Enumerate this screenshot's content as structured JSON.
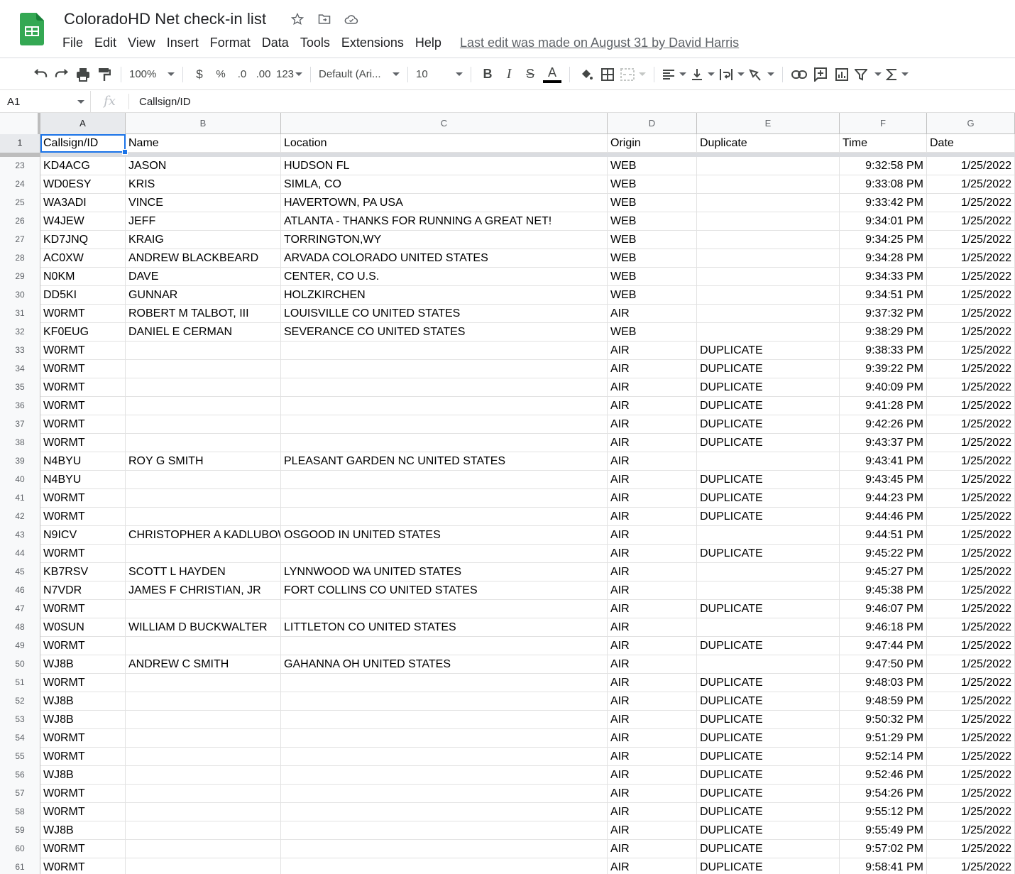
{
  "app": {
    "doc_title": "ColoradoHD Net check-in list",
    "icons": [
      "star-icon",
      "move-to-folder-icon",
      "cloud-saved-icon"
    ],
    "menu": [
      "File",
      "Edit",
      "View",
      "Insert",
      "Format",
      "Data",
      "Tools",
      "Extensions",
      "Help"
    ],
    "last_edit": "Last edit was made on August 31 by David Harris",
    "brand_color": "#34a853"
  },
  "toolbar": {
    "zoom": "100%",
    "currency": "$",
    "percent": "%",
    "decrease_decimal": ".0",
    "increase_decimal": ".00",
    "more_formats": "123",
    "font": "Default (Ari...",
    "font_size": "10",
    "bold": "B",
    "italic": "I",
    "strikethrough": "S",
    "text_color": "A"
  },
  "formula_bar": {
    "cell_ref": "A1",
    "fx": "fx",
    "value": "Callsign/ID"
  },
  "columns": [
    "A",
    "B",
    "C",
    "D",
    "E",
    "F",
    "G"
  ],
  "header_row": {
    "num": "1",
    "cells": [
      "Callsign/ID",
      "Name",
      "Location",
      "Origin",
      "Duplicate",
      "Time",
      "Date"
    ]
  },
  "rows": [
    {
      "num": "23",
      "cells": [
        "KD4ACG",
        "JASON",
        "HUDSON FL",
        "WEB",
        "",
        "9:32:58 PM",
        "1/25/2022"
      ]
    },
    {
      "num": "24",
      "cells": [
        "WD0ESY",
        "KRIS",
        "SIMLA, CO",
        "WEB",
        "",
        "9:33:08 PM",
        "1/25/2022"
      ]
    },
    {
      "num": "25",
      "cells": [
        "WA3ADI",
        "VINCE",
        "HAVERTOWN, PA USA",
        "WEB",
        "",
        "9:33:42 PM",
        "1/25/2022"
      ]
    },
    {
      "num": "26",
      "cells": [
        "W4JEW",
        "JEFF",
        "ATLANTA - THANKS FOR RUNNING A GREAT NET!",
        "WEB",
        "",
        "9:34:01 PM",
        "1/25/2022"
      ]
    },
    {
      "num": "27",
      "cells": [
        "KD7JNQ",
        "KRAIG",
        "TORRINGTON,WY",
        "WEB",
        "",
        "9:34:25 PM",
        "1/25/2022"
      ]
    },
    {
      "num": "28",
      "cells": [
        "AC0XW",
        "ANDREW BLACKBEARD",
        "ARVADA COLORADO UNITED STATES",
        "WEB",
        "",
        "9:34:28 PM",
        "1/25/2022"
      ]
    },
    {
      "num": "29",
      "cells": [
        "N0KM",
        "DAVE",
        "CENTER, CO U.S.",
        "WEB",
        "",
        "9:34:33 PM",
        "1/25/2022"
      ]
    },
    {
      "num": "30",
      "cells": [
        "DD5KI",
        "GUNNAR",
        "HOLZKIRCHEN",
        "WEB",
        "",
        "9:34:51 PM",
        "1/25/2022"
      ]
    },
    {
      "num": "31",
      "cells": [
        "W0RMT",
        "ROBERT M TALBOT, III",
        "LOUISVILLE CO UNITED STATES",
        "AIR",
        "",
        "9:37:32 PM",
        "1/25/2022"
      ]
    },
    {
      "num": "32",
      "cells": [
        "KF0EUG",
        "DANIEL E CERMAN",
        "SEVERANCE CO UNITED STATES",
        "WEB",
        "",
        "9:38:29 PM",
        "1/25/2022"
      ]
    },
    {
      "num": "33",
      "cells": [
        "W0RMT",
        "",
        "",
        "AIR",
        "DUPLICATE",
        "9:38:33 PM",
        "1/25/2022"
      ]
    },
    {
      "num": "34",
      "cells": [
        "W0RMT",
        "",
        "",
        "AIR",
        "DUPLICATE",
        "9:39:22 PM",
        "1/25/2022"
      ]
    },
    {
      "num": "35",
      "cells": [
        "W0RMT",
        "",
        "",
        "AIR",
        "DUPLICATE",
        "9:40:09 PM",
        "1/25/2022"
      ]
    },
    {
      "num": "36",
      "cells": [
        "W0RMT",
        "",
        "",
        "AIR",
        "DUPLICATE",
        "9:41:28 PM",
        "1/25/2022"
      ]
    },
    {
      "num": "37",
      "cells": [
        "W0RMT",
        "",
        "",
        "AIR",
        "DUPLICATE",
        "9:42:26 PM",
        "1/25/2022"
      ]
    },
    {
      "num": "38",
      "cells": [
        "W0RMT",
        "",
        "",
        "AIR",
        "DUPLICATE",
        "9:43:37 PM",
        "1/25/2022"
      ]
    },
    {
      "num": "39",
      "cells": [
        "N4BYU",
        "ROY G SMITH",
        "PLEASANT GARDEN NC UNITED STATES",
        "AIR",
        "",
        "9:43:41 PM",
        "1/25/2022"
      ]
    },
    {
      "num": "40",
      "cells": [
        "N4BYU",
        "",
        "",
        "AIR",
        "DUPLICATE",
        "9:43:45 PM",
        "1/25/2022"
      ]
    },
    {
      "num": "41",
      "cells": [
        "W0RMT",
        "",
        "",
        "AIR",
        "DUPLICATE",
        "9:44:23 PM",
        "1/25/2022"
      ]
    },
    {
      "num": "42",
      "cells": [
        "W0RMT",
        "",
        "",
        "AIR",
        "DUPLICATE",
        "9:44:46 PM",
        "1/25/2022"
      ]
    },
    {
      "num": "43",
      "cells": [
        "N9ICV",
        "CHRISTOPHER A KADLUBOWSKI",
        "OSGOOD IN UNITED STATES",
        "AIR",
        "",
        "9:44:51 PM",
        "1/25/2022"
      ]
    },
    {
      "num": "44",
      "cells": [
        "W0RMT",
        "",
        "",
        "AIR",
        "DUPLICATE",
        "9:45:22 PM",
        "1/25/2022"
      ]
    },
    {
      "num": "45",
      "cells": [
        "KB7RSV",
        "SCOTT L HAYDEN",
        "LYNNWOOD WA UNITED STATES",
        "AIR",
        "",
        "9:45:27 PM",
        "1/25/2022"
      ]
    },
    {
      "num": "46",
      "cells": [
        "N7VDR",
        "JAMES F CHRISTIAN, JR",
        "FORT COLLINS CO UNITED STATES",
        "AIR",
        "",
        "9:45:38 PM",
        "1/25/2022"
      ]
    },
    {
      "num": "47",
      "cells": [
        "W0RMT",
        "",
        "",
        "AIR",
        "DUPLICATE",
        "9:46:07 PM",
        "1/25/2022"
      ]
    },
    {
      "num": "48",
      "cells": [
        "W0SUN",
        "WILLIAM D BUCKWALTER",
        "LITTLETON CO UNITED STATES",
        "AIR",
        "",
        "9:46:18 PM",
        "1/25/2022"
      ]
    },
    {
      "num": "49",
      "cells": [
        "W0RMT",
        "",
        "",
        "AIR",
        "DUPLICATE",
        "9:47:44 PM",
        "1/25/2022"
      ]
    },
    {
      "num": "50",
      "cells": [
        "WJ8B",
        "ANDREW C SMITH",
        "GAHANNA OH UNITED STATES",
        "AIR",
        "",
        "9:47:50 PM",
        "1/25/2022"
      ]
    },
    {
      "num": "51",
      "cells": [
        "W0RMT",
        "",
        "",
        "AIR",
        "DUPLICATE",
        "9:48:03 PM",
        "1/25/2022"
      ]
    },
    {
      "num": "52",
      "cells": [
        "WJ8B",
        "",
        "",
        "AIR",
        "DUPLICATE",
        "9:48:59 PM",
        "1/25/2022"
      ]
    },
    {
      "num": "53",
      "cells": [
        "WJ8B",
        "",
        "",
        "AIR",
        "DUPLICATE",
        "9:50:32 PM",
        "1/25/2022"
      ]
    },
    {
      "num": "54",
      "cells": [
        "W0RMT",
        "",
        "",
        "AIR",
        "DUPLICATE",
        "9:51:29 PM",
        "1/25/2022"
      ]
    },
    {
      "num": "55",
      "cells": [
        "W0RMT",
        "",
        "",
        "AIR",
        "DUPLICATE",
        "9:52:14 PM",
        "1/25/2022"
      ]
    },
    {
      "num": "56",
      "cells": [
        "WJ8B",
        "",
        "",
        "AIR",
        "DUPLICATE",
        "9:52:46 PM",
        "1/25/2022"
      ]
    },
    {
      "num": "57",
      "cells": [
        "W0RMT",
        "",
        "",
        "AIR",
        "DUPLICATE",
        "9:54:26 PM",
        "1/25/2022"
      ]
    },
    {
      "num": "58",
      "cells": [
        "W0RMT",
        "",
        "",
        "AIR",
        "DUPLICATE",
        "9:55:12 PM",
        "1/25/2022"
      ]
    },
    {
      "num": "59",
      "cells": [
        "WJ8B",
        "",
        "",
        "AIR",
        "DUPLICATE",
        "9:55:49 PM",
        "1/25/2022"
      ]
    },
    {
      "num": "60",
      "cells": [
        "W0RMT",
        "",
        "",
        "AIR",
        "DUPLICATE",
        "9:57:02 PM",
        "1/25/2022"
      ]
    },
    {
      "num": "61",
      "cells": [
        "W0RMT",
        "",
        "",
        "AIR",
        "DUPLICATE",
        "9:58:41 PM",
        "1/25/2022"
      ]
    }
  ]
}
